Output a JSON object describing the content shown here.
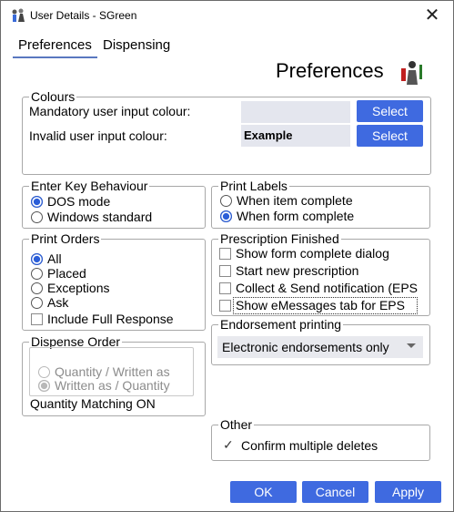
{
  "window": {
    "title": "User Details - SGreen",
    "icon": "user-details-icon"
  },
  "tabs": [
    {
      "label": "Preferences",
      "selected": true
    },
    {
      "label": "Dispensing",
      "selected": false
    }
  ],
  "page_title": "Preferences",
  "colours": {
    "legend": "Colours",
    "mandatory_label": "Mandatory user input colour:",
    "invalid_label": "Invalid user input colour:",
    "example_text": "Example",
    "select_label": "Select"
  },
  "enter_key": {
    "legend": "Enter Key Behaviour",
    "options": [
      "DOS mode",
      "Windows standard"
    ],
    "selected": "DOS mode"
  },
  "print_labels": {
    "legend": "Print Labels",
    "options": [
      "When item complete",
      "When form complete"
    ],
    "selected": "When form complete"
  },
  "print_orders": {
    "legend": "Print Orders",
    "options": [
      "All",
      "Placed",
      "Exceptions",
      "Ask"
    ],
    "selected": "All",
    "checkbox": "Include Full Response"
  },
  "prescription_finished": {
    "legend": "Prescription Finished",
    "items": [
      "Show form complete dialog",
      "Start new prescription",
      "Collect & Send notification (EPS",
      "Show eMessages tab for EPS"
    ]
  },
  "dispense_order": {
    "legend": "Dispense Order",
    "options": [
      "Quantity / Written as",
      "Written as / Quantity"
    ],
    "selected": "Written as / Quantity",
    "status": "Quantity Matching ON"
  },
  "endorsement": {
    "legend": "Endorsement printing",
    "value": "Electronic endorsements only"
  },
  "other": {
    "legend": "Other",
    "checkbox": "Confirm multiple deletes",
    "checked": true
  },
  "buttons": {
    "ok": "OK",
    "cancel": "Cancel",
    "apply": "Apply"
  },
  "colors": {
    "accent": "#3f6ae0",
    "swatch": "#e4e6ee"
  }
}
